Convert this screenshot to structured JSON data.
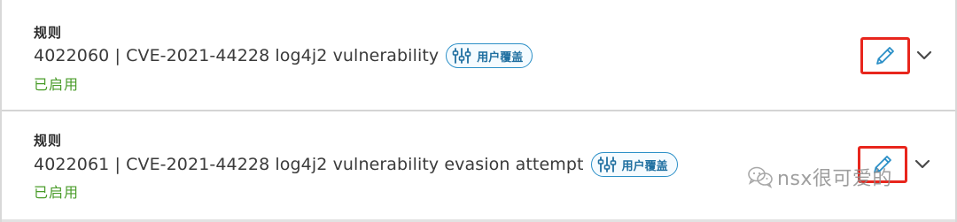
{
  "rules": [
    {
      "heading": "规则",
      "title": "4022060 | CVE-2021-44228 log4j2 vulnerability",
      "badge": "用户覆盖",
      "status": "已启用"
    },
    {
      "heading": "规则",
      "title": "4022061 | CVE-2021-44228 log4j2 vulnerability evasion attempt",
      "badge": "用户覆盖",
      "status": "已启用"
    }
  ],
  "watermark": {
    "text": "nsx很可爱的"
  },
  "colors": {
    "status_enabled": "#4a9c2a",
    "badge_border": "#2b8fc7",
    "icon_blue": "#2b8fc7",
    "highlight": "#e8261d"
  },
  "icons": {
    "badge": "sliders-icon",
    "edit": "pencil-icon",
    "expand": "chevron-down-icon",
    "watermark": "wechat-icon"
  }
}
